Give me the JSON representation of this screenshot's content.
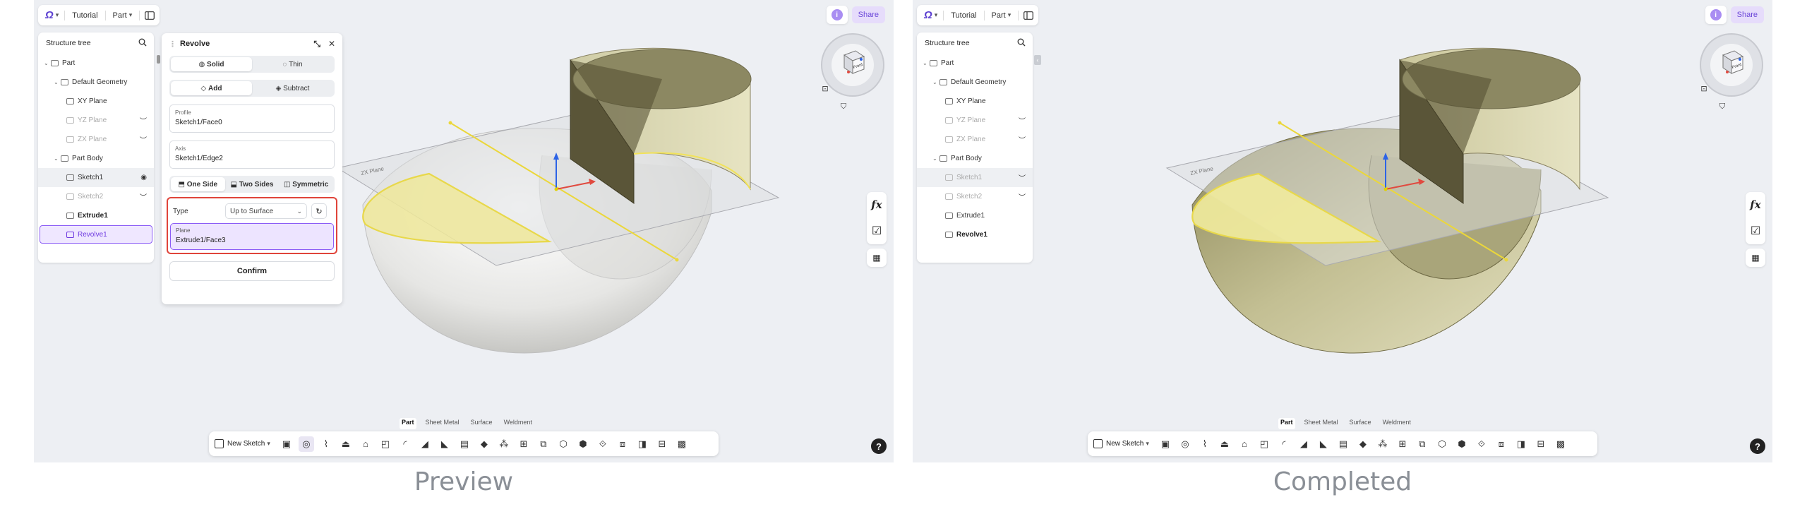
{
  "toolbar": {
    "tutorial_label": "Tutorial",
    "part_label": "Part",
    "share_label": "Share",
    "info_label": "i"
  },
  "tree": {
    "title": "Structure tree",
    "items": [
      {
        "label": "Part"
      },
      {
        "label": "Default Geometry"
      },
      {
        "label": "XY Plane"
      },
      {
        "label": "YZ Plane"
      },
      {
        "label": "ZX Plane"
      },
      {
        "label": "Part Body"
      },
      {
        "label": "Sketch1"
      },
      {
        "label": "Sketch2"
      },
      {
        "label": "Extrude1"
      },
      {
        "label": "Revolve1"
      }
    ]
  },
  "revolve": {
    "title": "Revolve",
    "solid_label": "Solid",
    "thin_label": "Thin",
    "add_label": "Add",
    "subtract_label": "Subtract",
    "profile_label": "Profile",
    "profile_value": "Sketch1/Face0",
    "axis_label": "Axis",
    "axis_value": "Sketch1/Edge2",
    "one_side_label": "One Side",
    "two_sides_label": "Two Sides",
    "symmetric_label": "Symmetric",
    "type_label": "Type",
    "type_value": "Up to Surface",
    "plane_label": "Plane",
    "plane_value": "Extrude1/Face3",
    "confirm_label": "Confirm"
  },
  "viewcube": {
    "face_label": "Front"
  },
  "bottom": {
    "tabs": [
      "Part",
      "Sheet Metal",
      "Surface",
      "Weldment"
    ],
    "new_sketch_label": "New Sketch"
  },
  "viewport": {
    "plane_tag": "ZX Plane"
  },
  "captions": {
    "preview": "Preview",
    "completed": "Completed"
  },
  "colors": {
    "accent": "#8b5cf6",
    "highlight_frame": "#e0443a",
    "solid_fill": "#b8b489",
    "profile_yellow": "#f3e650"
  }
}
